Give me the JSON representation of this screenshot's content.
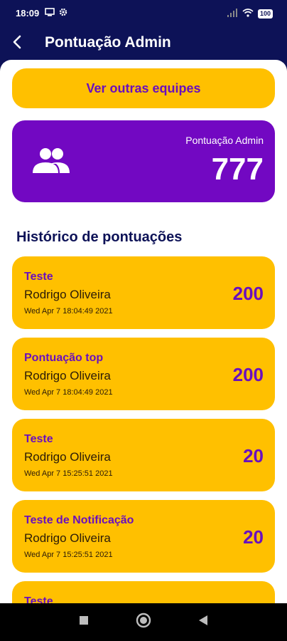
{
  "status_bar": {
    "time": "18:09",
    "battery": "100",
    "icons": [
      "screen-cast-icon",
      "gear-icon",
      "signal-icon",
      "wifi-icon",
      "battery-icon"
    ]
  },
  "app_bar": {
    "title": "Pontuação Admin",
    "back_icon": "back-arrow-icon"
  },
  "colors": {
    "primary_dark": "#0d1257",
    "accent_yellow": "#ffc000",
    "accent_purple": "#7208c2",
    "text_purple": "#6a0fbe"
  },
  "actions": {
    "other_teams_label": "Ver outras equipes"
  },
  "score_card": {
    "label": "Pontuação Admin",
    "value": "777",
    "icon": "group-icon"
  },
  "history": {
    "heading": "Histórico de pontuações",
    "items": [
      {
        "title": "Teste",
        "user": "Rodrigo Oliveira",
        "date": "Wed Apr  7 18:04:49 2021",
        "points": "200"
      },
      {
        "title": "Pontuação top",
        "user": "Rodrigo Oliveira",
        "date": "Wed Apr  7 18:04:49 2021",
        "points": "200"
      },
      {
        "title": "Teste",
        "user": "Rodrigo Oliveira",
        "date": "Wed Apr  7 15:25:51 2021",
        "points": "20"
      },
      {
        "title": "Teste de Notificação",
        "user": "Rodrigo Oliveira",
        "date": "Wed Apr  7 15:25:51 2021",
        "points": "20"
      },
      {
        "title": "Teste"
      }
    ]
  },
  "nav_bar": {
    "icons": [
      "recents-square-icon",
      "home-circle-icon",
      "back-triangle-icon"
    ]
  }
}
